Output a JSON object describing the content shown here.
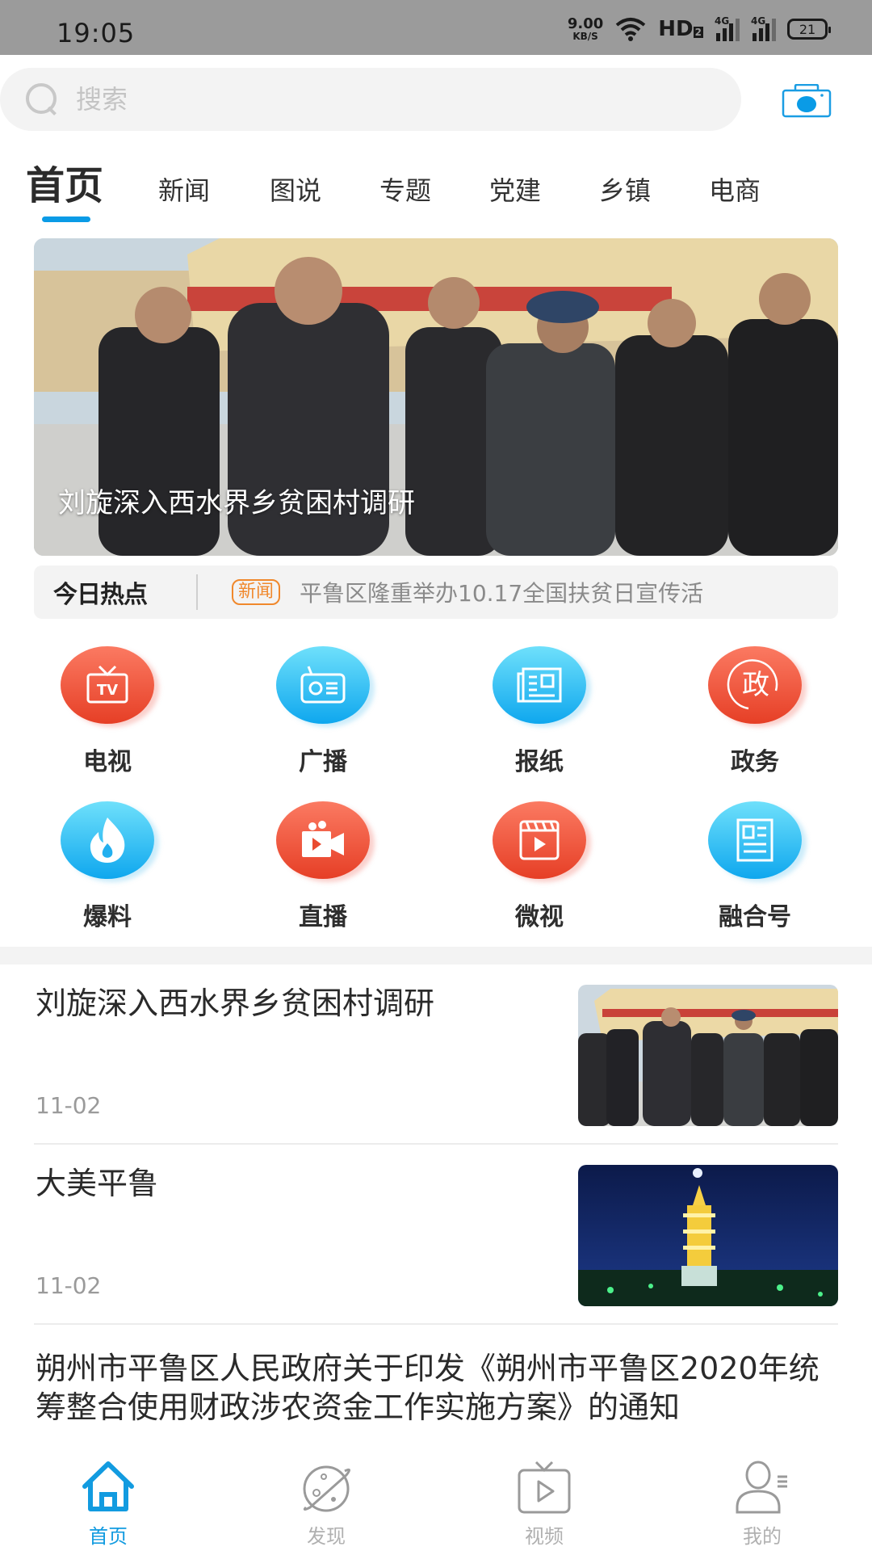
{
  "status_bar": {
    "time": "19:05",
    "net_speed_value": "9.00",
    "net_speed_unit": "KB/S",
    "hd_label": "HD",
    "hd_sub": "2",
    "sim1_label": "4G",
    "sim2_label": "4G",
    "battery": "21"
  },
  "search": {
    "placeholder": "搜索",
    "value": "",
    "icon": "search-icon"
  },
  "camera_icon": "camera-icon",
  "tabs": [
    {
      "label": "首页",
      "active": true
    },
    {
      "label": "新闻",
      "active": false
    },
    {
      "label": "图说",
      "active": false
    },
    {
      "label": "专题",
      "active": false
    },
    {
      "label": "党建",
      "active": false
    },
    {
      "label": "乡镇",
      "active": false
    },
    {
      "label": "电商",
      "active": false
    }
  ],
  "banner": {
    "caption": "刘旋深入西水界乡贫困村调研"
  },
  "hot": {
    "title": "今日热点",
    "tag": "新闻",
    "text": "平鲁区隆重举办10.17全国扶贫日宣传活"
  },
  "colors": {
    "accent_blue": "#0a9be6",
    "icon_red": "#e63f26",
    "icon_blue": "#0fa7ee",
    "hot_tag_orange": "#f0882c"
  },
  "grid": [
    {
      "label": "电视",
      "icon": "tv-icon",
      "color": "red"
    },
    {
      "label": "广播",
      "icon": "radio-icon",
      "color": "blue"
    },
    {
      "label": "报纸",
      "icon": "newspaper-icon",
      "color": "blue"
    },
    {
      "label": "政务",
      "icon": "government-icon",
      "color": "red",
      "glyph": "政"
    },
    {
      "label": "爆料",
      "icon": "flame-icon",
      "color": "blue"
    },
    {
      "label": "直播",
      "icon": "video-camera-icon",
      "color": "red"
    },
    {
      "label": "微视",
      "icon": "clapperboard-icon",
      "color": "red"
    },
    {
      "label": "融合号",
      "icon": "document-icon",
      "color": "blue"
    }
  ],
  "news": [
    {
      "title": "刘旋深入西水界乡贫困村调研",
      "date": "11-02",
      "thumb": "group-photo"
    },
    {
      "title": "大美平鲁",
      "date": "11-02",
      "thumb": "pagoda-night"
    },
    {
      "title": "朔州市平鲁区人民政府关于印发《朔州市平鲁区2020年统筹整合使用财政涉农资金工作实施方案》的通知"
    }
  ],
  "bottom_nav": [
    {
      "label": "首页",
      "icon": "home-icon",
      "active": true
    },
    {
      "label": "发现",
      "icon": "planet-icon",
      "active": false
    },
    {
      "label": "视频",
      "icon": "video-tv-icon",
      "active": false
    },
    {
      "label": "我的",
      "icon": "user-icon",
      "active": false
    }
  ]
}
